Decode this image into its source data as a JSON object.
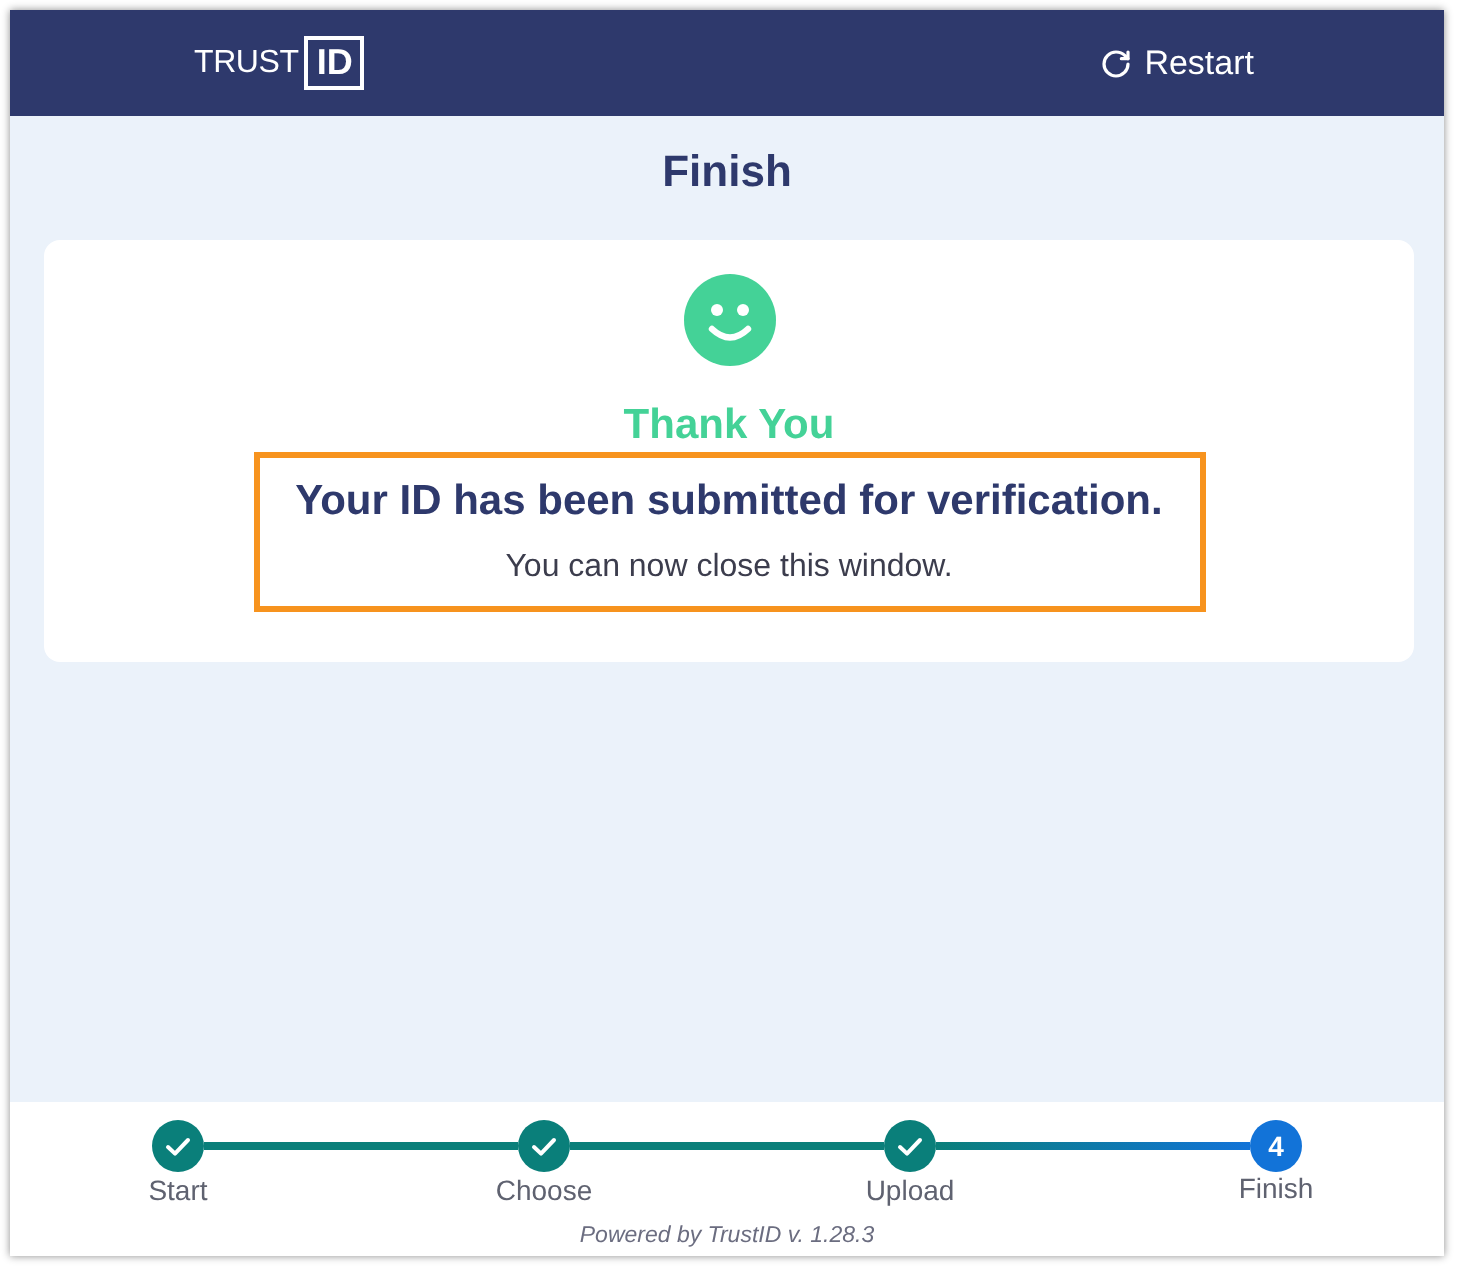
{
  "header": {
    "logo": {
      "text": "TRUST",
      "boxed_text": "ID"
    },
    "restart_button": {
      "label": "Restart"
    }
  },
  "page_title": "Finish",
  "card": {
    "heading": "Thank You",
    "highlight": true,
    "message": "Your ID has been submitted for verification.",
    "note": "You can now close this window."
  },
  "steps": [
    {
      "label": "Start",
      "completed": true
    },
    {
      "label": "Choose",
      "completed": true
    },
    {
      "label": "Upload",
      "completed": true
    },
    {
      "label": "Finish",
      "completed": false,
      "number": "4"
    }
  ],
  "footer": {
    "powered_by": "Powered by TrustID v. 1.28.3"
  }
}
